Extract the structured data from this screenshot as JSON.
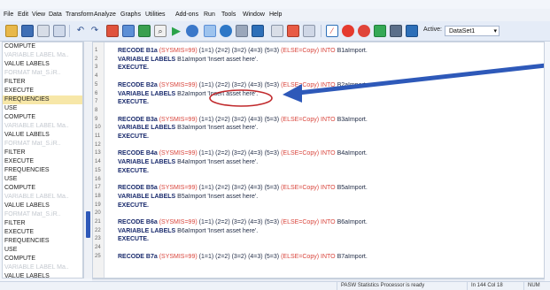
{
  "menubar": {
    "items": [
      "File",
      "Edit",
      "View",
      "Data",
      "Transform",
      "Analyze",
      "Graphs",
      "Utilities",
      "Add-ons",
      "Run",
      "Tools",
      "Window",
      "Help"
    ]
  },
  "toolbar": {
    "active_label": "Active:",
    "dataset_value": "DataSet1",
    "colors": {
      "play": "#2aa34a",
      "record_red": "#e53b2f",
      "green_check": "#35a956",
      "blue": "#2d6fb8"
    }
  },
  "outline": {
    "items": [
      {
        "label": "COMPUTE",
        "faded": false,
        "selected": false
      },
      {
        "label": "VARIABLE LABEL Ma..",
        "faded": true,
        "selected": false
      },
      {
        "label": "VALUE LABELS",
        "faded": false,
        "selected": false
      },
      {
        "label": "FORMAT Mat_S.iR..",
        "faded": true,
        "selected": false
      },
      {
        "label": "FILTER",
        "faded": false,
        "selected": false
      },
      {
        "label": "EXECUTE",
        "faded": false,
        "selected": false
      },
      {
        "label": "FREQUENCIES",
        "faded": false,
        "selected": true
      },
      {
        "label": "USE",
        "faded": false,
        "selected": false
      },
      {
        "label": "COMPUTE",
        "faded": false,
        "selected": false
      },
      {
        "label": "VARIABLE LABEL Ma..",
        "faded": true,
        "selected": false
      },
      {
        "label": "VALUE LABELS",
        "faded": false,
        "selected": false
      },
      {
        "label": "FORMAT Mat_S.iR..",
        "faded": true,
        "selected": false
      },
      {
        "label": "FILTER",
        "faded": false,
        "selected": false
      },
      {
        "label": "EXECUTE",
        "faded": false,
        "selected": false
      },
      {
        "label": "FREQUENCIES",
        "faded": false,
        "selected": false
      },
      {
        "label": "USE",
        "faded": false,
        "selected": false
      },
      {
        "label": "COMPUTE",
        "faded": false,
        "selected": false
      },
      {
        "label": "VARIABLE LABEL Ma..",
        "faded": true,
        "selected": false
      },
      {
        "label": "VALUE LABELS",
        "faded": false,
        "selected": false
      },
      {
        "label": "FORMAT Mat_S.iR..",
        "faded": true,
        "selected": false
      },
      {
        "label": "FILTER",
        "faded": false,
        "selected": false
      },
      {
        "label": "EXECUTE",
        "faded": false,
        "selected": false
      },
      {
        "label": "FREQUENCIES",
        "faded": false,
        "selected": false
      },
      {
        "label": "USE",
        "faded": false,
        "selected": false
      },
      {
        "label": "COMPUTE",
        "faded": false,
        "selected": false
      },
      {
        "label": "VARIABLE LABEL Ma..",
        "faded": true,
        "selected": false
      },
      {
        "label": "VALUE LABELS",
        "faded": false,
        "selected": false
      }
    ]
  },
  "editor": {
    "lines": [
      {
        "n": "1",
        "kind": "recode",
        "text": "RECODE B1a",
        "paren": "(SYSMIS=99)",
        "mid": "(1=1) (2=2) (3=2) (4=3) (5=3)",
        "else": "(ELSE=Copy)",
        "into": "INTO",
        "target": "B1aImport."
      },
      {
        "n": "2",
        "kind": "label",
        "kw": "VARIABLE LABELS",
        "rest": "B1aImport 'Insert asset here'."
      },
      {
        "n": "3",
        "kind": "exec",
        "kw": "EXECUTE."
      },
      {
        "n": "4",
        "kind": "blank"
      },
      {
        "n": "5",
        "kind": "recode",
        "text": "RECODE B2a",
        "paren": "(SYSMIS=99)",
        "mid": "(1=1) (2=2) (3=2) (4=3) (5=3)",
        "else": "(ELSE=Copy)",
        "into": "INTO",
        "target": "B2aImport."
      },
      {
        "n": "6",
        "kind": "label",
        "kw": "VARIABLE LABELS",
        "rest": "B2aImport 'Insert asset here'."
      },
      {
        "n": "7",
        "kind": "exec",
        "kw": "EXECUTE."
      },
      {
        "n": "8",
        "kind": "blank"
      },
      {
        "n": "9",
        "kind": "recode",
        "text": "RECODE B3a",
        "paren": "(SYSMIS=99)",
        "mid": "(1=1) (2=2) (3=2) (4=3) (5=3)",
        "else": "(ELSE=Copy)",
        "into": "INTO",
        "target": "B3aImport."
      },
      {
        "n": "10",
        "kind": "label",
        "kw": "VARIABLE LABELS",
        "rest": "B3aImport 'Insert asset here'."
      },
      {
        "n": "11",
        "kind": "exec",
        "kw": "EXECUTE."
      },
      {
        "n": "12",
        "kind": "blank"
      },
      {
        "n": "13",
        "kind": "recode",
        "text": "RECODE B4a",
        "paren": "(SYSMIS=99)",
        "mid": "(1=1) (2=2) (3=2) (4=3) (5=3)",
        "else": "(ELSE=Copy)",
        "into": "INTO",
        "target": "B4aImport."
      },
      {
        "n": "14",
        "kind": "label",
        "kw": "VARIABLE LABELS",
        "rest": "B4aImport 'Insert asset here'."
      },
      {
        "n": "15",
        "kind": "exec",
        "kw": "EXECUTE."
      },
      {
        "n": "16",
        "kind": "blank"
      },
      {
        "n": "17",
        "kind": "recode",
        "text": "RECODE B5a",
        "paren": "(SYSMIS=99)",
        "mid": "(1=1) (2=2) (3=2) (4=3) (5=3)",
        "else": "(ELSE=Copy)",
        "into": "INTO",
        "target": "B5aImport."
      },
      {
        "n": "18",
        "kind": "label",
        "kw": "VARIABLE LABELS",
        "rest": "B5aImport 'Insert asset here'."
      },
      {
        "n": "19",
        "kind": "exec",
        "kw": "EXECUTE."
      },
      {
        "n": "20",
        "kind": "blank"
      },
      {
        "n": "21",
        "kind": "recode",
        "text": "RECODE B6a",
        "paren": "(SYSMIS=99)",
        "mid": "(1=1) (2=2) (3=2) (4=3) (5=3)",
        "else": "(ELSE=Copy)",
        "into": "INTO",
        "target": "B6aImport."
      },
      {
        "n": "22",
        "kind": "label",
        "kw": "VARIABLE LABELS",
        "rest": "B6aImport 'Insert asset here'."
      },
      {
        "n": "23",
        "kind": "exec",
        "kw": "EXECUTE."
      },
      {
        "n": "24",
        "kind": "blank"
      },
      {
        "n": "25",
        "kind": "recode",
        "text": "RECODE B7a",
        "paren": "(SYSMIS=99)",
        "mid": "(1=1) (2=2) (3=2) (4=3) (5=3)",
        "else": "(ELSE=Copy)",
        "into": "INTO",
        "target": "B7aImport."
      }
    ],
    "colors": {
      "keyword": "#1a2b6d",
      "secondary": "#d9453c",
      "annotation": "#c0282b",
      "arrow": "#2e59b9"
    }
  },
  "statusbar": {
    "processor": "PASW Statistics Processor is ready",
    "position": "In 144 Col 18",
    "num": "NUM"
  }
}
